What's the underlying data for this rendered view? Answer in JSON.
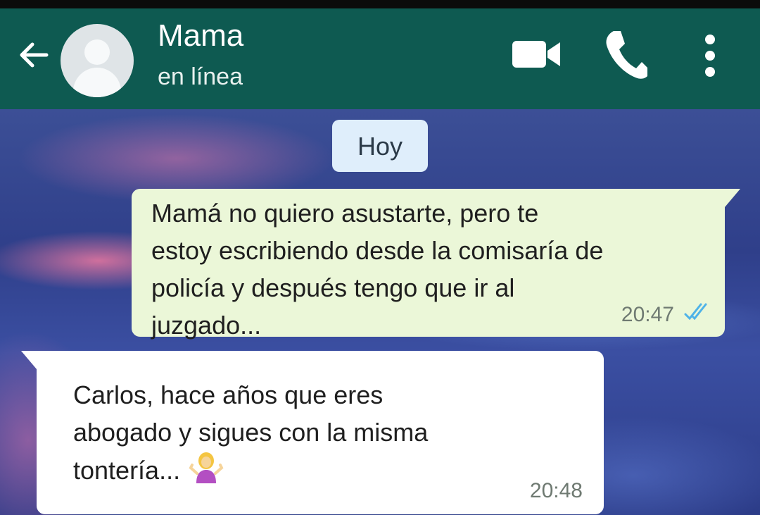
{
  "header": {
    "contact_name": "Mama",
    "status": "en línea",
    "color": "#0e5a51",
    "icons": [
      "back-arrow-icon",
      "avatar",
      "video-call-icon",
      "phone-icon",
      "more-options-icon"
    ]
  },
  "chat": {
    "date_label": "Hoy",
    "messages": [
      {
        "direction": "outgoing",
        "text": "Mamá no quiero asustarte, pero te\nestoy escribiendo desde la comisaría de\npolicía y después tengo que ir al\njuzgado...",
        "time": "20:47",
        "read": true
      },
      {
        "direction": "incoming",
        "text": "Carlos, hace años que eres\nabogado y sigues con la misma\ntontería...",
        "emoji": "woman-shrugging-emoji",
        "time": "20:48"
      }
    ]
  },
  "colors": {
    "outgoing_bubble": "#ebf7d8",
    "incoming_bubble": "#ffffff",
    "read_ticks": "#4fb3e8"
  }
}
